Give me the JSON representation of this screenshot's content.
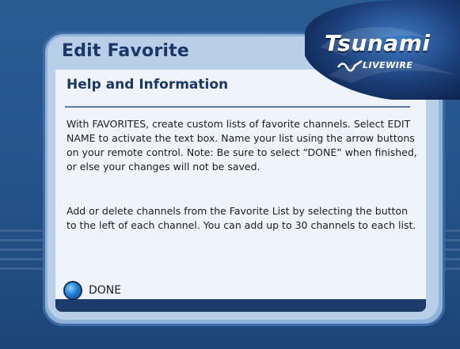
{
  "title": "Edit Favorite",
  "heading": "Help and Information",
  "paragraph1": "With FAVORITES, create custom lists of favorite channels. Select EDIT NAME to activate the text box. Name your list using the arrow buttons on your remote control. Note: Be sure to select “DONE” when finished, or else your changes will not be saved.",
  "paragraph2": "Add or delete channels from the Favorite List by selecting the button to the left of each channel.  You can add up to 30 channels to each list.",
  "done_label": "DONE",
  "logo": {
    "main": "Tsunami",
    "sub": "LIVEWIRE"
  },
  "colors": {
    "background": "#24538a",
    "panel": "#b9cfe8",
    "content": "#eff4fc",
    "title_text": "#1a3768",
    "accent": "#1f84d8"
  }
}
